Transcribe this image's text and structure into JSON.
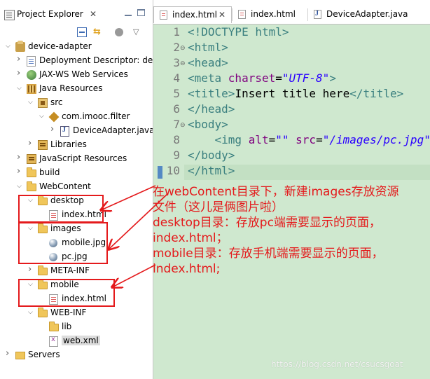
{
  "explorer": {
    "title": "Project Explorer",
    "close": "✕",
    "tree": [
      {
        "label": "device-adapter",
        "depth": 0,
        "twisty": "⌵",
        "icon": "project-icon",
        "cls": "ic-proj"
      },
      {
        "label": "Deployment Descriptor: de",
        "depth": 1,
        "twisty": ">",
        "icon": "descriptor-icon",
        "cls": "ic-desc"
      },
      {
        "label": "JAX-WS Web Services",
        "depth": 1,
        "twisty": ">",
        "icon": "web-services-icon",
        "cls": "ic-ws"
      },
      {
        "label": "Java Resources",
        "depth": 1,
        "twisty": "⌵",
        "icon": "java-resources-icon",
        "cls": "ic-jres"
      },
      {
        "label": "src",
        "depth": 2,
        "twisty": "⌵",
        "icon": "source-folder-icon",
        "cls": "ic-pkgf"
      },
      {
        "label": "com.imooc.filter",
        "depth": 3,
        "twisty": "⌵",
        "icon": "package-icon",
        "cls": "ic-pkg"
      },
      {
        "label": "DeviceAdapter.java",
        "depth": 4,
        "twisty": ">",
        "icon": "java-file-icon",
        "cls": "ic-java"
      },
      {
        "label": "Libraries",
        "depth": 2,
        "twisty": ">",
        "icon": "libraries-icon",
        "cls": "ic-lib"
      },
      {
        "label": "JavaScript Resources",
        "depth": 1,
        "twisty": ">",
        "icon": "javascript-resources-icon",
        "cls": "ic-lib"
      },
      {
        "label": "build",
        "depth": 1,
        "twisty": ">",
        "icon": "folder-icon",
        "cls": "ic-folder"
      },
      {
        "label": "WebContent",
        "depth": 1,
        "twisty": "⌵",
        "icon": "folder-icon",
        "cls": "ic-folder"
      },
      {
        "label": "desktop",
        "depth": 2,
        "twisty": "⌵",
        "icon": "folder-icon",
        "cls": "ic-folder"
      },
      {
        "label": "index.html",
        "depth": 3,
        "twisty": "",
        "icon": "html-file-icon",
        "cls": "ic-html"
      },
      {
        "label": "images",
        "depth": 2,
        "twisty": "⌵",
        "icon": "folder-icon",
        "cls": "ic-folder"
      },
      {
        "label": "mobile.jpg",
        "depth": 3,
        "twisty": "",
        "icon": "image-file-icon",
        "cls": "ic-img"
      },
      {
        "label": "pc.jpg",
        "depth": 3,
        "twisty": "",
        "icon": "image-file-icon",
        "cls": "ic-img"
      },
      {
        "label": "META-INF",
        "depth": 2,
        "twisty": ">",
        "icon": "folder-icon",
        "cls": "ic-folder"
      },
      {
        "label": "mobile",
        "depth": 2,
        "twisty": "⌵",
        "icon": "folder-icon",
        "cls": "ic-folder"
      },
      {
        "label": "index.html",
        "depth": 3,
        "twisty": "",
        "icon": "html-file-icon",
        "cls": "ic-html"
      },
      {
        "label": "WEB-INF",
        "depth": 2,
        "twisty": "⌵",
        "icon": "folder-icon",
        "cls": "ic-folder"
      },
      {
        "label": "lib",
        "depth": 3,
        "twisty": "",
        "icon": "folder-icon",
        "cls": "ic-folder"
      },
      {
        "label": "web.xml",
        "depth": 3,
        "twisty": "",
        "icon": "xml-file-icon",
        "cls": "ic-xml",
        "selected": true
      },
      {
        "label": "Servers",
        "depth": 0,
        "twisty": ">",
        "icon": "server-folder-icon",
        "cls": "ic-server"
      }
    ]
  },
  "editor": {
    "tabs": [
      {
        "label": "index.html",
        "close": "✕",
        "active": true,
        "icon": "html"
      },
      {
        "label": "index.html",
        "close": "",
        "active": false,
        "icon": "html"
      },
      {
        "label": "DeviceAdapter.java",
        "close": "",
        "active": false,
        "icon": "java"
      }
    ],
    "line_numbers": [
      "1",
      "2",
      "3",
      "4",
      "5",
      "6",
      "7",
      "8",
      "9",
      "10"
    ],
    "fold_marks": [
      "",
      "⊖",
      "⊖",
      "",
      "",
      "",
      "⊖",
      "",
      "",
      ""
    ],
    "code": [
      [
        [
          "tag",
          "<!DOCTYPE "
        ],
        [
          "kw",
          "html"
        ],
        [
          "tag",
          ">"
        ]
      ],
      [
        [
          "tag",
          "<html>"
        ]
      ],
      [
        [
          "tag",
          "<head>"
        ]
      ],
      [
        [
          "tag",
          "<meta "
        ],
        [
          "at",
          "charset"
        ],
        [
          "tx",
          "="
        ],
        [
          "st",
          "\"UTF-8\""
        ],
        [
          "tag",
          ">"
        ]
      ],
      [
        [
          "tag",
          "<title>"
        ],
        [
          "tx",
          "Insert title here"
        ],
        [
          "tag",
          "</title>"
        ]
      ],
      [
        [
          "tag",
          "</head>"
        ]
      ],
      [
        [
          "tag",
          "<body>"
        ]
      ],
      [
        [
          "tx",
          "    "
        ],
        [
          "tag",
          "<img "
        ],
        [
          "at",
          "alt"
        ],
        [
          "tx",
          "="
        ],
        [
          "st",
          "\"\""
        ],
        [
          "tx",
          " "
        ],
        [
          "at",
          "src"
        ],
        [
          "tx",
          "="
        ],
        [
          "st",
          "\"/images/pc.jpg\""
        ]
      ],
      [
        [
          "tag",
          "</body>"
        ]
      ],
      [
        [
          "tag",
          "</html>"
        ]
      ]
    ]
  },
  "annotation": {
    "lines": [
      "在webContent目录下，新建images存放资源",
      "文件（这儿是俩图片啦）",
      "desktop目录：存放pc端需要显示的页面，",
      "index.html；",
      "mobile目录：存放手机端需要显示的页面，",
      "index.html;"
    ],
    "color": "#e41a1c"
  },
  "watermark": "https://blog.csdn.net/csucsgoat"
}
